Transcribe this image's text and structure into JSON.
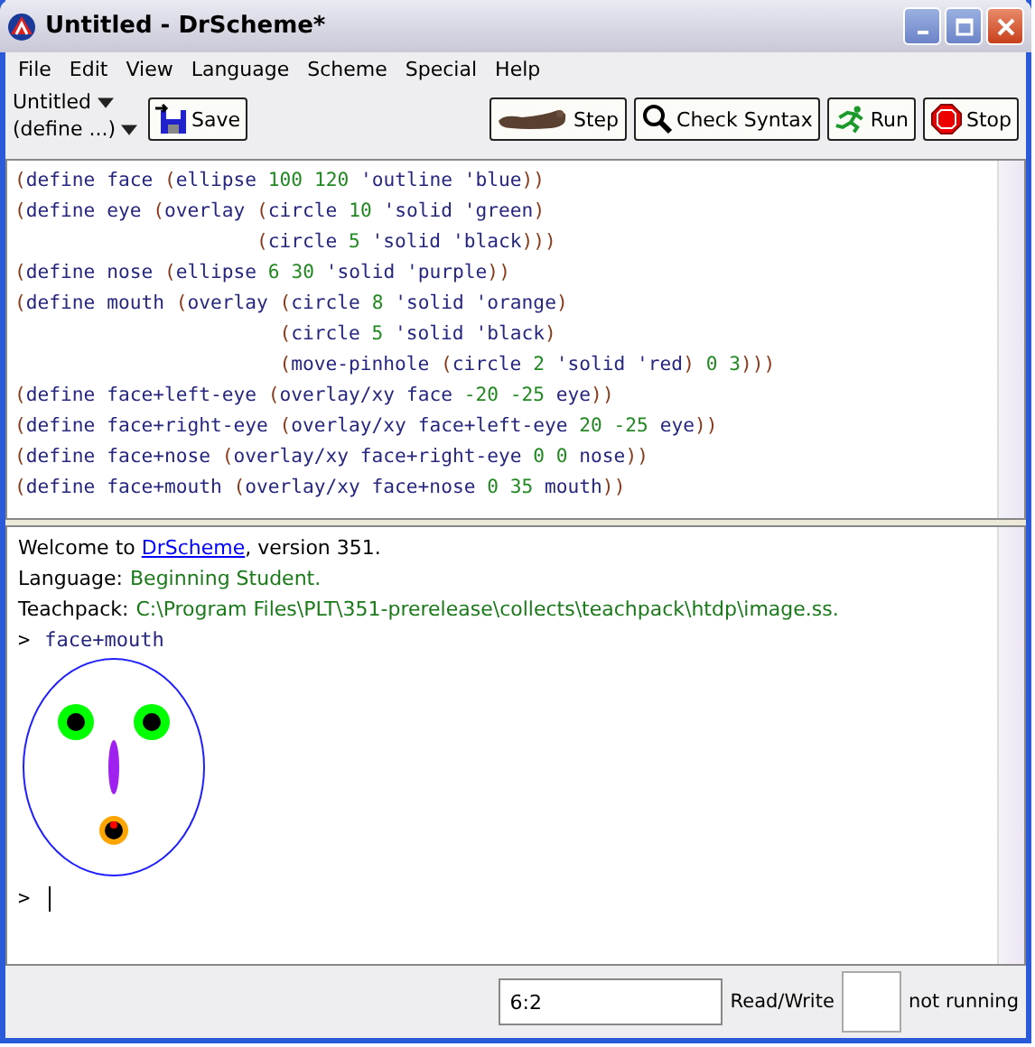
{
  "window": {
    "title": "Untitled - DrScheme*"
  },
  "menu": [
    "File",
    "Edit",
    "View",
    "Language",
    "Scheme",
    "Special",
    "Help"
  ],
  "toolbar": {
    "file_menu": "Untitled",
    "define_menu": "(define ...)",
    "save": "Save",
    "buttons": [
      {
        "kind": "step",
        "label": "Step"
      },
      {
        "kind": "check",
        "label": "Check Syntax"
      },
      {
        "kind": "run",
        "label": "Run"
      },
      {
        "kind": "stop",
        "label": "Stop"
      }
    ]
  },
  "definitions": [
    "(define face (ellipse 100 120 'outline 'blue))",
    "(define eye (overlay (circle 10 'solid 'green)",
    "                     (circle 5 'solid 'black)))",
    "(define nose (ellipse 6 30 'solid 'purple))",
    "(define mouth (overlay (circle 8 'solid 'orange)",
    "                       (circle 5 'solid 'black)",
    "                       (move-pinhole (circle 2 'solid 'red) 0 3)))",
    "(define face+left-eye (overlay/xy face -20 -25 eye))",
    "(define face+right-eye (overlay/xy face+left-eye 20 -25 eye))",
    "(define face+nose (overlay/xy face+right-eye 0 0 nose))",
    "(define face+mouth (overlay/xy face+nose 0 35 mouth))"
  ],
  "interactions": {
    "welcome": {
      "before": "Welcome to ",
      "link": "DrScheme",
      "after": ", version 351."
    },
    "info": [
      {
        "label": "Language:",
        "value": "Beginning Student."
      },
      {
        "label": "Teachpack:",
        "value": "C:\\Program Files\\PLT\\351-prerelease\\collects\\teachpack\\htdp\\image.ss."
      }
    ],
    "prompt": ">",
    "input": "face+mouth",
    "next_prompt": ">"
  },
  "status_bar": {
    "position": "6:2",
    "mode": "Read/Write",
    "state": "not running"
  }
}
